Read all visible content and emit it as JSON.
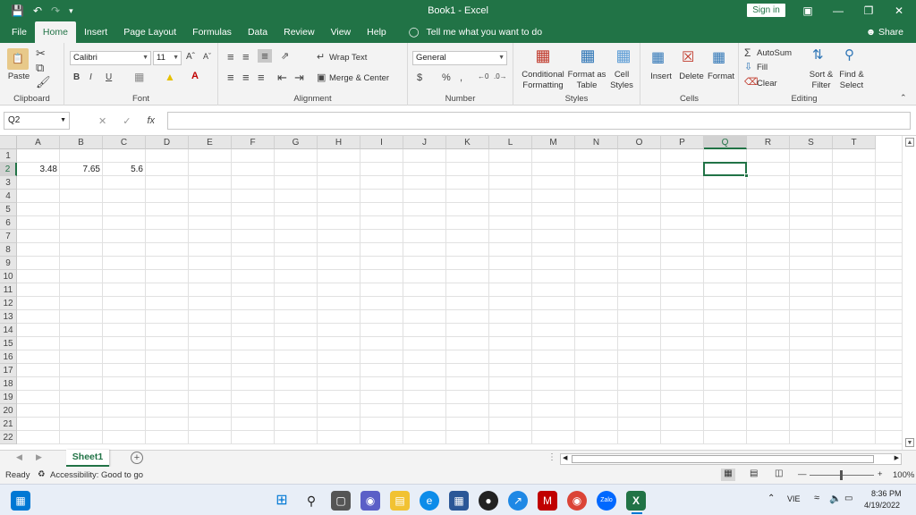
{
  "window": {
    "title": "Book1  -  Excel",
    "sign_in": "Sign in",
    "share": "Share"
  },
  "tabs": [
    "File",
    "Home",
    "Insert",
    "Page Layout",
    "Formulas",
    "Data",
    "Review",
    "View",
    "Help"
  ],
  "tell_me": "Tell me what you want to do",
  "ribbon": {
    "clipboard": {
      "paste": "Paste",
      "label": "Clipboard"
    },
    "font": {
      "name": "Calibri",
      "size": "11",
      "label": "Font"
    },
    "alignment": {
      "wrap": "Wrap Text",
      "merge": "Merge & Center",
      "label": "Alignment"
    },
    "number": {
      "format": "General",
      "label": "Number",
      "currency": "$",
      "percent": "%",
      "comma": ","
    },
    "styles": {
      "conditional": "Conditional",
      "conditional2": "Formatting",
      "format_as": "Format as",
      "format_as2": "Table",
      "cell": "Cell",
      "cell2": "Styles",
      "label": "Styles"
    },
    "cells": {
      "insert": "Insert",
      "delete": "Delete",
      "format": "Format",
      "label": "Cells"
    },
    "editing": {
      "autosum": "AutoSum",
      "fill": "Fill",
      "clear": "Clear",
      "sort": "Sort &",
      "sort2": "Filter",
      "find": "Find &",
      "find2": "Select",
      "label": "Editing"
    }
  },
  "formula_bar": {
    "name_box": "Q2",
    "fx": "fx",
    "content": ""
  },
  "columns": [
    "A",
    "B",
    "C",
    "D",
    "E",
    "F",
    "G",
    "H",
    "I",
    "J",
    "K",
    "L",
    "M",
    "N",
    "O",
    "P",
    "Q",
    "R",
    "S",
    "T"
  ],
  "rows": [
    "1",
    "2",
    "3",
    "4",
    "5",
    "6",
    "7",
    "8",
    "9",
    "10",
    "11",
    "12",
    "13",
    "14",
    "15",
    "16",
    "17",
    "18",
    "19",
    "20",
    "21",
    "22"
  ],
  "cells": {
    "A2": "3.48",
    "B2": "7.65",
    "C2": "5.6"
  },
  "selected": {
    "col": "Q",
    "row": "2"
  },
  "sheet": {
    "name": "Sheet1",
    "add": "+"
  },
  "status": {
    "ready": "Ready",
    "accessibility": "Accessibility: Good to go",
    "zoom": "100%"
  },
  "taskbar": {
    "lang": "VIE",
    "time": "8:36 PM",
    "date": "4/19/2022"
  },
  "colors": {
    "accent": "#217346"
  }
}
